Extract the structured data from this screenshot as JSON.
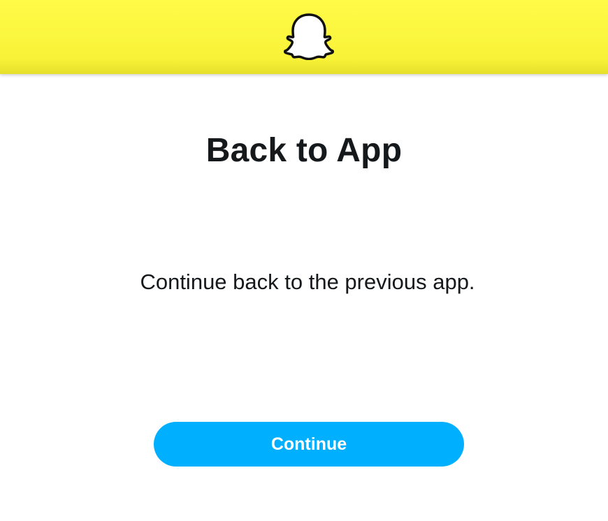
{
  "header": {
    "logo_icon": "snapchat-ghost-icon",
    "background_color": "#fffc00"
  },
  "main": {
    "title": "Back to App",
    "message": "Continue back to the previous app.",
    "continue_label": "Continue",
    "button_color": "#00b0ff"
  }
}
